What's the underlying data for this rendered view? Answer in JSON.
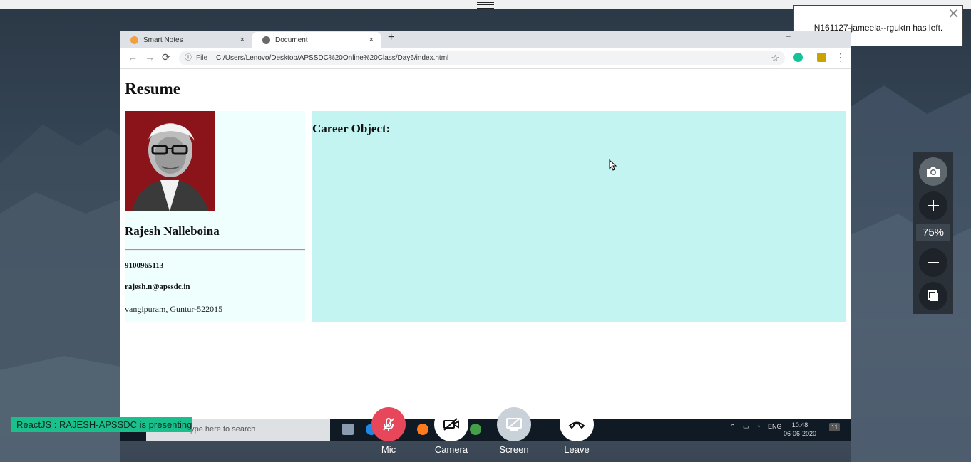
{
  "notification": {
    "text": "N161127-jameela--rguktn has left.",
    "close": "✕"
  },
  "browser": {
    "tabs": [
      {
        "label": "Smart Notes",
        "close": "×"
      },
      {
        "label": "Document",
        "close": "×"
      }
    ],
    "new_tab": "+",
    "minimize": "–",
    "nav": {
      "back": "←",
      "forward": "→",
      "reload": "⟳"
    },
    "address": {
      "scheme": "File",
      "url": "C:/Users/Lenovo/Desktop/APSSDC%20Online%20Class/Day6/index.html"
    },
    "star": "☆",
    "menu": "⋮"
  },
  "page": {
    "heading": "Resume",
    "name": "Rajesh Nalleboina",
    "phone": "9100965113",
    "email": "rajesh.n@apssdc.in",
    "address": "vangipuram, Guntur-522015",
    "career_title": "Career Object:"
  },
  "taskbar": {
    "search_placeholder": "Type here to search",
    "lang": "ENG",
    "time": "10:48",
    "date": "06-06-2020",
    "notif_count": "11"
  },
  "presenting": "ReactJS : RAJESH-APSSDC is presenting",
  "controls": {
    "mic": "Mic",
    "camera": "Camera",
    "screen": "Screen",
    "leave": "Leave"
  },
  "zoom": {
    "level": "75%"
  },
  "colors": {
    "left_panel_bg": "#eefffe",
    "right_panel_bg": "#c3f4f1",
    "mic_muted": "#e8465a",
    "presenting_banner": "#1bbf8c"
  }
}
